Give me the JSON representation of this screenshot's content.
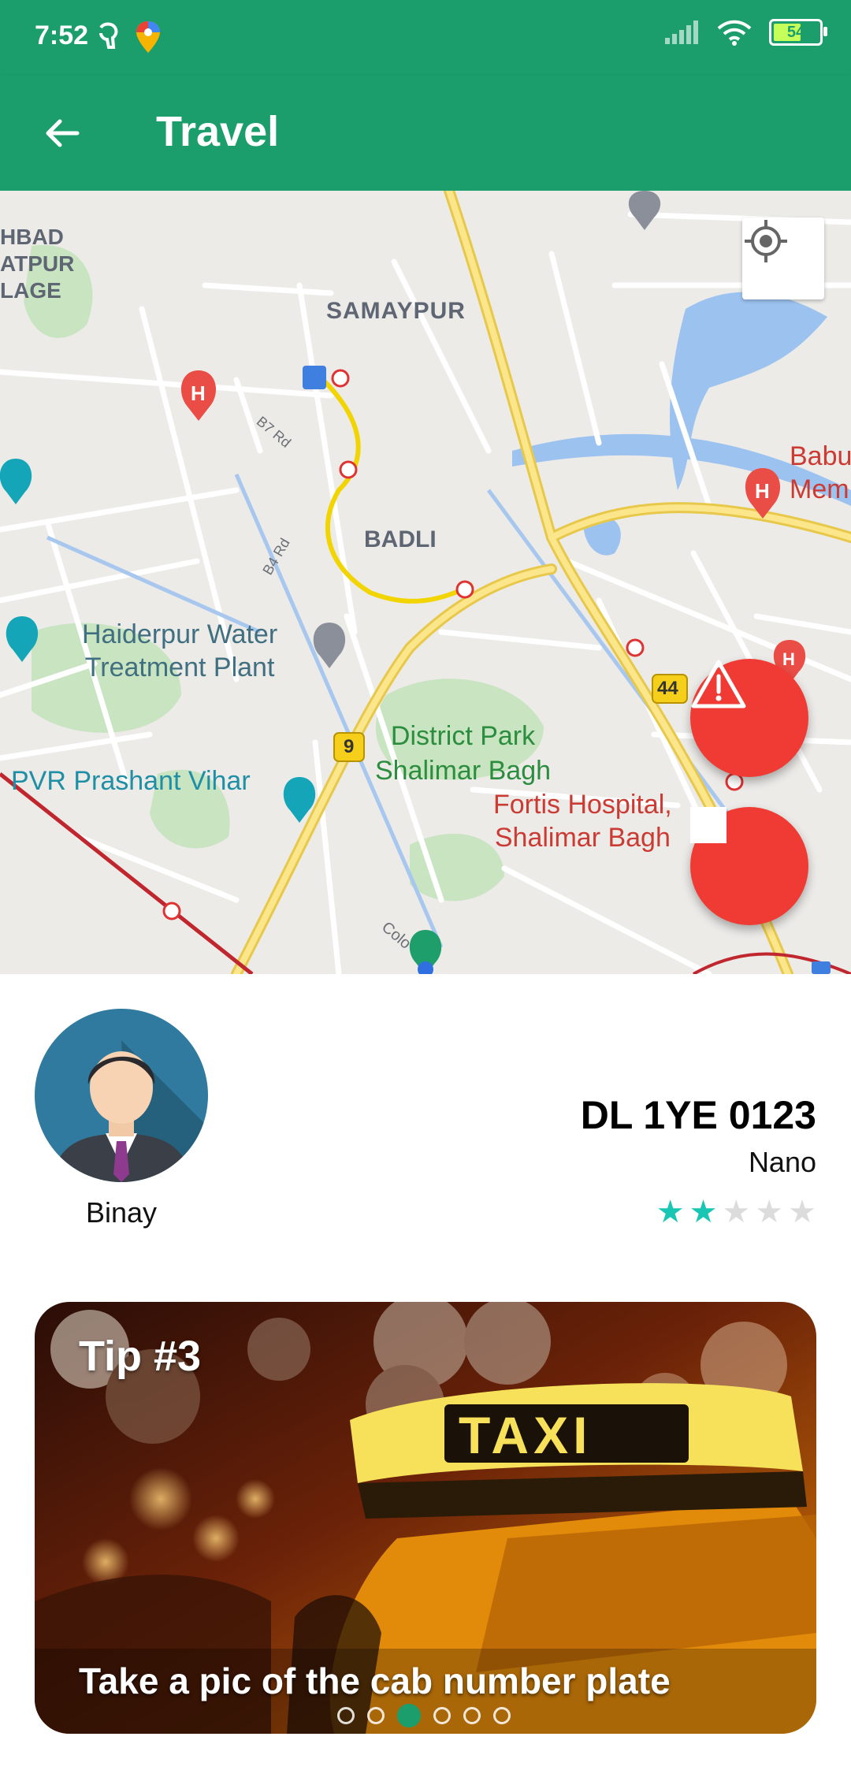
{
  "status_bar": {
    "time": "7:52",
    "battery": "54"
  },
  "app_bar": {
    "title": "Travel"
  },
  "map": {
    "labels": {
      "samaypur": "SAMAYPUR",
      "badli": "BADLI",
      "haiderpur": "Haiderpur Water\nTreatment Plant",
      "district_park": "District Park\nShalimar Bagh",
      "fortis": "Fortis Hospital,\nShalimar Bagh",
      "pvr": "PVR Prashant Vihar",
      "babu": "Babu\nMem",
      "left_edge": "HBAD\nATPUR\nLAGE",
      "b7_rd": "B7 Rd",
      "b4_rd": "B4 Rd",
      "route_9": "9",
      "route_44": "44",
      "colony": "Colo"
    }
  },
  "driver": {
    "name": "Binay",
    "plate": "DL 1YE 0123",
    "model": "Nano",
    "rating": 2,
    "rating_max": 5,
    "star_color": "#19c6b3"
  },
  "tip": {
    "title": "Tip #3",
    "caption": "Take a pic of the cab number plate",
    "page": 3,
    "pages": 6
  },
  "colors": {
    "primary": "#1b9e6b",
    "danger": "#ef3b33"
  }
}
